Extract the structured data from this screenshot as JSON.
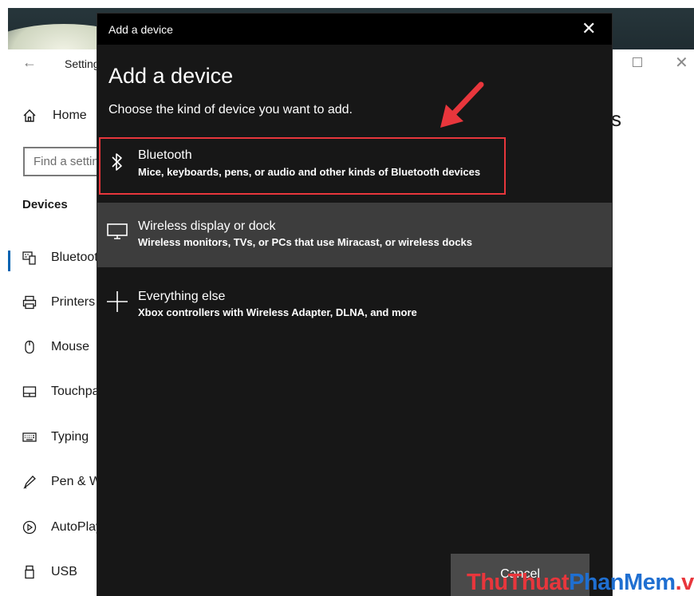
{
  "settings": {
    "title": "Settings",
    "heading_peek": "s",
    "home_label": "Home",
    "search_placeholder": "Find a setting",
    "section_label": "Devices",
    "nav_items": [
      {
        "label": "Bluetooth & other devices",
        "icon": "keyboard-device-icon"
      },
      {
        "label": "Printers & scanners",
        "icon": "printer-icon"
      },
      {
        "label": "Mouse",
        "icon": "mouse-icon"
      },
      {
        "label": "Touchpad",
        "icon": "touchpad-icon"
      },
      {
        "label": "Typing",
        "icon": "keyboard-icon"
      },
      {
        "label": "Pen & Windows Ink",
        "icon": "pen-icon"
      },
      {
        "label": "AutoPlay",
        "icon": "autoplay-icon"
      },
      {
        "label": "USB",
        "icon": "usb-icon"
      }
    ]
  },
  "dialog": {
    "window_title": "Add a device",
    "heading": "Add a device",
    "subtitle": "Choose the kind of device you want to add.",
    "options": [
      {
        "title": "Bluetooth",
        "description": "Mice, keyboards, pens, or audio and other kinds of Bluetooth devices",
        "icon": "bluetooth-icon"
      },
      {
        "title": "Wireless display or dock",
        "description": "Wireless monitors, TVs, or PCs that use Miracast, or wireless docks",
        "icon": "monitor-icon"
      },
      {
        "title": "Everything else",
        "description": "Xbox controllers with Wireless Adapter, DLNA, and more",
        "icon": "plus-icon"
      }
    ],
    "cancel_label": "Cancel"
  },
  "watermark": {
    "part1": "ThuThuat",
    "part2": "PhanMem",
    "part3": ".vn"
  },
  "colors": {
    "highlight": "#e8363c",
    "dialog_bg": "#171717",
    "selected_option_bg": "#3d3d3d",
    "accent": "#0063b1"
  }
}
